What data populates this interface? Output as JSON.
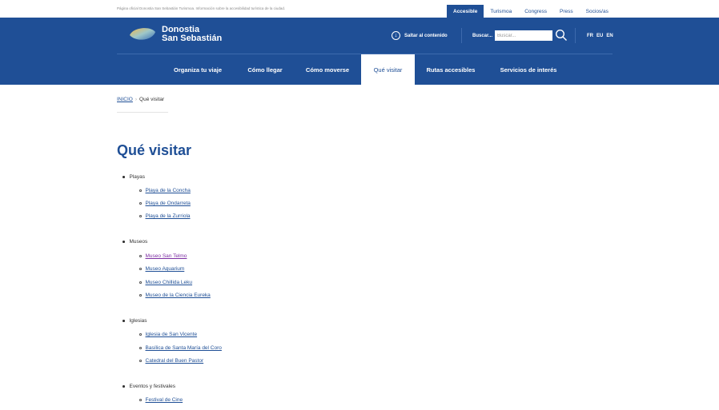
{
  "top_bar": {
    "note": "Página oficial Donostia San Sebastián Turismoa. Información sobre la accesibilidad turística de la ciudad.",
    "tabs": [
      {
        "label": "Accesible",
        "active": true
      },
      {
        "label": "Turismoa",
        "active": false
      },
      {
        "label": "Congress",
        "active": false
      },
      {
        "label": "Press",
        "active": false
      },
      {
        "label": "Socios/as",
        "active": false
      }
    ]
  },
  "header": {
    "logo_line1": "Donostia",
    "logo_line2": "San Sebastián",
    "skip_icon": "arrow-down-circle-icon",
    "skip_label": "Saltar al contenido",
    "search_label": "Buscar...",
    "search_placeholder": "Buscar...",
    "search_value": "",
    "search_icon": "search-icon",
    "languages": [
      "FR",
      "EU",
      "EN"
    ]
  },
  "nav": {
    "items": [
      {
        "label": "Organiza tu viaje",
        "active": false
      },
      {
        "label": "Cómo llegar",
        "active": false
      },
      {
        "label": "Cómo moverse",
        "active": false
      },
      {
        "label": "Qué visitar",
        "active": true
      },
      {
        "label": "Rutas accesibles",
        "active": false
      },
      {
        "label": "Servicios de interés",
        "active": false
      }
    ]
  },
  "breadcrumb": {
    "home": "INICIO",
    "separator": "›",
    "current": "Qué visitar"
  },
  "page": {
    "title": "Qué visitar",
    "categories": [
      {
        "label": "Playas",
        "items": [
          "Playa de la Concha",
          "Playa de Ondarreta",
          "Playa de la Zurriola"
        ]
      },
      {
        "label": "Museos",
        "items": [
          "Museo San Telmo",
          "Museo Aquarium",
          "Museo Chillida Leku",
          "Museo de la Ciencia Eureka"
        ]
      },
      {
        "label": "Iglesias",
        "items": [
          "Iglesia de San Vicente",
          "Basílica de Santa María del Coro",
          "Catedral del Buen Pastor"
        ]
      },
      {
        "label": "Eventos y festivales",
        "items": [
          "Festival de Cine"
        ]
      }
    ]
  },
  "colors": {
    "brand": "#1f4f96",
    "visited_link": "#7d2fa3",
    "header_bg": "#1f4f96"
  }
}
